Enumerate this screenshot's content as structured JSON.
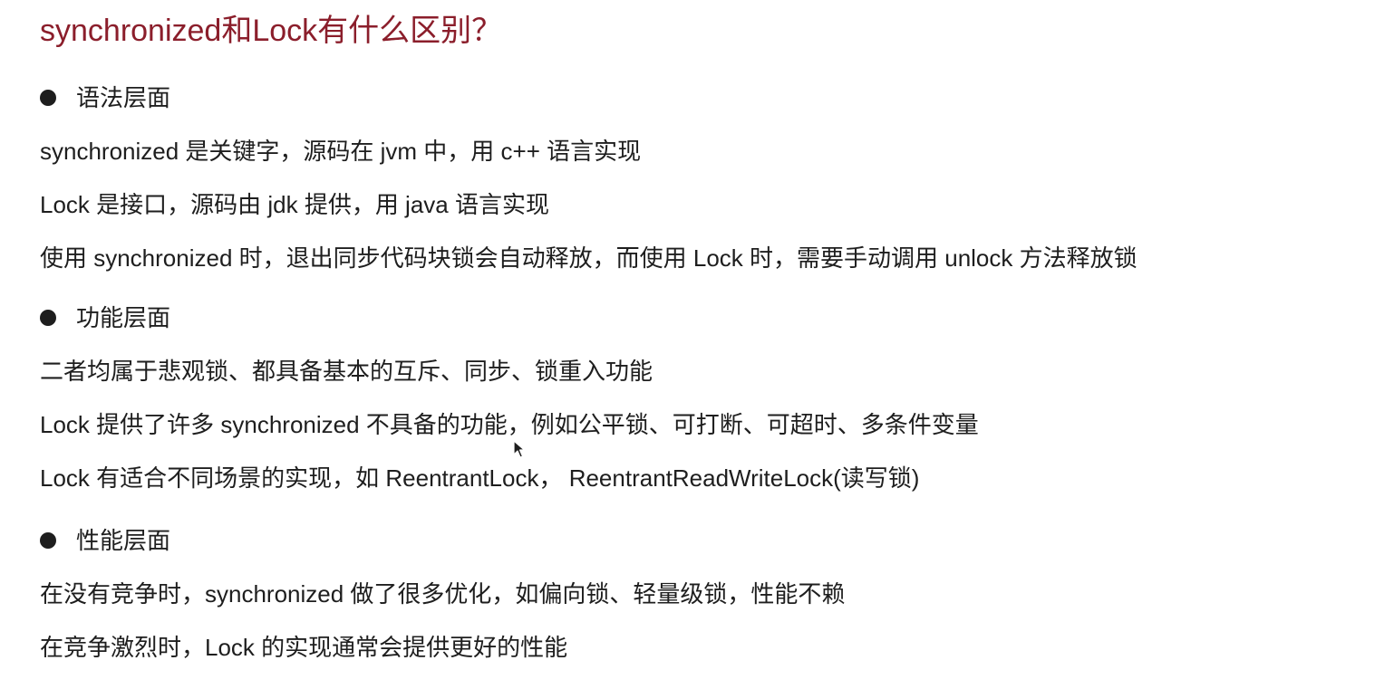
{
  "title": "synchronized和Lock有什么区别？",
  "sections": [
    {
      "heading": "语法层面",
      "lines": [
        "synchronized 是关键字，源码在 jvm 中，用 c++ 语言实现",
        "Lock 是接口，源码由 jdk 提供，用 java 语言实现",
        "使用 synchronized 时，退出同步代码块锁会自动释放，而使用 Lock 时，需要手动调用 unlock 方法释放锁"
      ]
    },
    {
      "heading": "功能层面",
      "lines": [
        "二者均属于悲观锁、都具备基本的互斥、同步、锁重入功能",
        "Lock 提供了许多 synchronized 不具备的功能，例如公平锁、可打断、可超时、多条件变量",
        "Lock 有适合不同场景的实现，如 ReentrantLock， ReentrantReadWriteLock(读写锁)"
      ]
    },
    {
      "heading": "性能层面",
      "lines": [
        "在没有竞争时，synchronized 做了很多优化，如偏向锁、轻量级锁，性能不赖",
        "在竞争激烈时，Lock 的实现通常会提供更好的性能"
      ]
    }
  ],
  "icons": {
    "bullet": "bullet-dot-icon",
    "cursor": "mouse-pointer-icon"
  },
  "colors": {
    "title": "#8b1e2b",
    "text": "#1e1e1e",
    "background": "#ffffff"
  }
}
